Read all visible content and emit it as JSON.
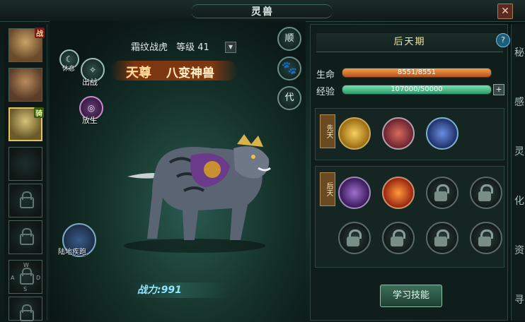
{
  "window": {
    "title": "灵兽",
    "close_label": "✕"
  },
  "sidebar": {
    "tags": {
      "battle": "战",
      "mount": "骑"
    },
    "wasd": {
      "w": "W",
      "a": "A",
      "d": "D",
      "s": "S"
    }
  },
  "pet": {
    "name": "霜纹战虎",
    "level_text": "等级 41",
    "rank": "天尊",
    "class": "八变神兽",
    "power_label": "战力:991"
  },
  "left_actions": {
    "rest": "休息",
    "summon": "出战",
    "release": "放生",
    "sprint": "陆地疾跑"
  },
  "right_actions": {
    "obey": "顺",
    "replace": "代"
  },
  "panel": {
    "phase": "后天期",
    "hp_label": "生命",
    "hp_value": "8551/8551",
    "exp_label": "经验",
    "exp_value": "107000/50000",
    "innate_label": "先天",
    "acquired_label": "后天",
    "learn_button": "学习技能"
  },
  "edge_chars": [
    "秘",
    "感",
    "灵",
    "化",
    "资",
    "寻"
  ]
}
